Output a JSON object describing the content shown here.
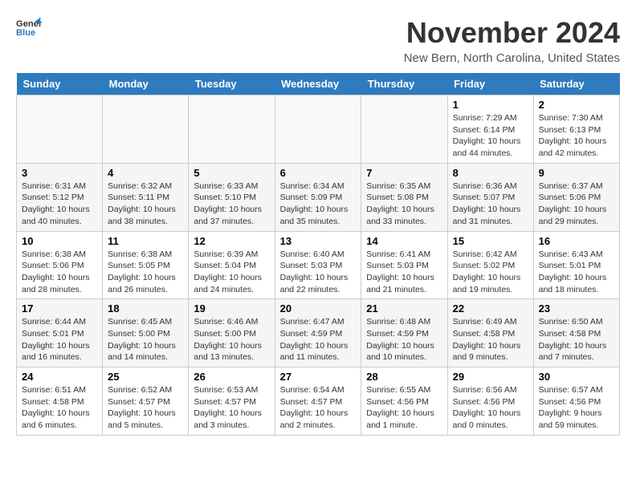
{
  "header": {
    "logo_line1": "General",
    "logo_line2": "Blue",
    "title": "November 2024",
    "subtitle": "New Bern, North Carolina, United States"
  },
  "calendar": {
    "days_of_week": [
      "Sunday",
      "Monday",
      "Tuesday",
      "Wednesday",
      "Thursday",
      "Friday",
      "Saturday"
    ],
    "weeks": [
      [
        {
          "day": "",
          "info": ""
        },
        {
          "day": "",
          "info": ""
        },
        {
          "day": "",
          "info": ""
        },
        {
          "day": "",
          "info": ""
        },
        {
          "day": "",
          "info": ""
        },
        {
          "day": "1",
          "info": "Sunrise: 7:29 AM\nSunset: 6:14 PM\nDaylight: 10 hours and 44 minutes."
        },
        {
          "day": "2",
          "info": "Sunrise: 7:30 AM\nSunset: 6:13 PM\nDaylight: 10 hours and 42 minutes."
        }
      ],
      [
        {
          "day": "3",
          "info": "Sunrise: 6:31 AM\nSunset: 5:12 PM\nDaylight: 10 hours and 40 minutes."
        },
        {
          "day": "4",
          "info": "Sunrise: 6:32 AM\nSunset: 5:11 PM\nDaylight: 10 hours and 38 minutes."
        },
        {
          "day": "5",
          "info": "Sunrise: 6:33 AM\nSunset: 5:10 PM\nDaylight: 10 hours and 37 minutes."
        },
        {
          "day": "6",
          "info": "Sunrise: 6:34 AM\nSunset: 5:09 PM\nDaylight: 10 hours and 35 minutes."
        },
        {
          "day": "7",
          "info": "Sunrise: 6:35 AM\nSunset: 5:08 PM\nDaylight: 10 hours and 33 minutes."
        },
        {
          "day": "8",
          "info": "Sunrise: 6:36 AM\nSunset: 5:07 PM\nDaylight: 10 hours and 31 minutes."
        },
        {
          "day": "9",
          "info": "Sunrise: 6:37 AM\nSunset: 5:06 PM\nDaylight: 10 hours and 29 minutes."
        }
      ],
      [
        {
          "day": "10",
          "info": "Sunrise: 6:38 AM\nSunset: 5:06 PM\nDaylight: 10 hours and 28 minutes."
        },
        {
          "day": "11",
          "info": "Sunrise: 6:38 AM\nSunset: 5:05 PM\nDaylight: 10 hours and 26 minutes."
        },
        {
          "day": "12",
          "info": "Sunrise: 6:39 AM\nSunset: 5:04 PM\nDaylight: 10 hours and 24 minutes."
        },
        {
          "day": "13",
          "info": "Sunrise: 6:40 AM\nSunset: 5:03 PM\nDaylight: 10 hours and 22 minutes."
        },
        {
          "day": "14",
          "info": "Sunrise: 6:41 AM\nSunset: 5:03 PM\nDaylight: 10 hours and 21 minutes."
        },
        {
          "day": "15",
          "info": "Sunrise: 6:42 AM\nSunset: 5:02 PM\nDaylight: 10 hours and 19 minutes."
        },
        {
          "day": "16",
          "info": "Sunrise: 6:43 AM\nSunset: 5:01 PM\nDaylight: 10 hours and 18 minutes."
        }
      ],
      [
        {
          "day": "17",
          "info": "Sunrise: 6:44 AM\nSunset: 5:01 PM\nDaylight: 10 hours and 16 minutes."
        },
        {
          "day": "18",
          "info": "Sunrise: 6:45 AM\nSunset: 5:00 PM\nDaylight: 10 hours and 14 minutes."
        },
        {
          "day": "19",
          "info": "Sunrise: 6:46 AM\nSunset: 5:00 PM\nDaylight: 10 hours and 13 minutes."
        },
        {
          "day": "20",
          "info": "Sunrise: 6:47 AM\nSunset: 4:59 PM\nDaylight: 10 hours and 11 minutes."
        },
        {
          "day": "21",
          "info": "Sunrise: 6:48 AM\nSunset: 4:59 PM\nDaylight: 10 hours and 10 minutes."
        },
        {
          "day": "22",
          "info": "Sunrise: 6:49 AM\nSunset: 4:58 PM\nDaylight: 10 hours and 9 minutes."
        },
        {
          "day": "23",
          "info": "Sunrise: 6:50 AM\nSunset: 4:58 PM\nDaylight: 10 hours and 7 minutes."
        }
      ],
      [
        {
          "day": "24",
          "info": "Sunrise: 6:51 AM\nSunset: 4:58 PM\nDaylight: 10 hours and 6 minutes."
        },
        {
          "day": "25",
          "info": "Sunrise: 6:52 AM\nSunset: 4:57 PM\nDaylight: 10 hours and 5 minutes."
        },
        {
          "day": "26",
          "info": "Sunrise: 6:53 AM\nSunset: 4:57 PM\nDaylight: 10 hours and 3 minutes."
        },
        {
          "day": "27",
          "info": "Sunrise: 6:54 AM\nSunset: 4:57 PM\nDaylight: 10 hours and 2 minutes."
        },
        {
          "day": "28",
          "info": "Sunrise: 6:55 AM\nSunset: 4:56 PM\nDaylight: 10 hours and 1 minute."
        },
        {
          "day": "29",
          "info": "Sunrise: 6:56 AM\nSunset: 4:56 PM\nDaylight: 10 hours and 0 minutes."
        },
        {
          "day": "30",
          "info": "Sunrise: 6:57 AM\nSunset: 4:56 PM\nDaylight: 9 hours and 59 minutes."
        }
      ]
    ]
  }
}
